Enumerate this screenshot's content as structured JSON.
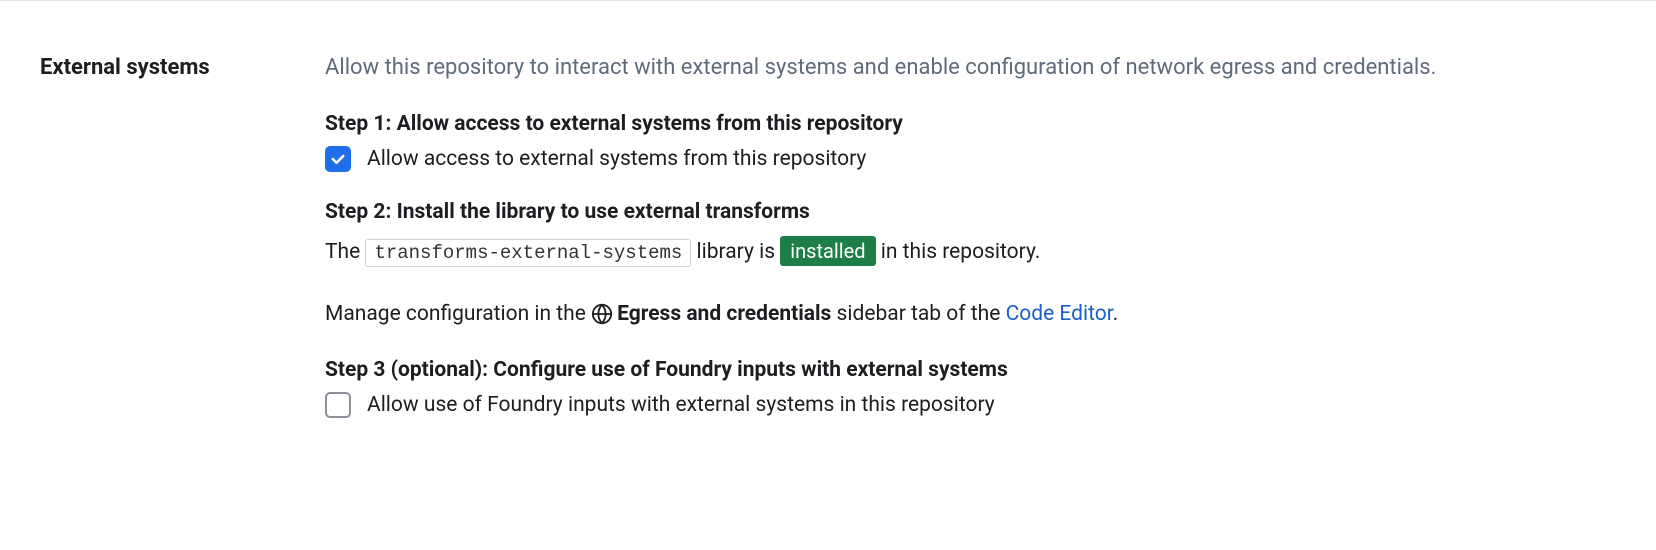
{
  "section": {
    "label": "External systems",
    "description": "Allow this repository to interact with external systems and enable configuration of network egress and credentials."
  },
  "step1": {
    "title": "Step 1: Allow access to external systems from this repository",
    "checkbox_label": "Allow access to external systems from this repository",
    "checked": true
  },
  "step2": {
    "title": "Step 2: Install the library to use external transforms",
    "prefix": "The ",
    "library_name": "transforms-external-systems",
    "mid1": " library is ",
    "status": "installed",
    "suffix": " in this repository."
  },
  "manage": {
    "prefix": "Manage configuration in the ",
    "sidebar_label": "Egress and credentials",
    "mid": " sidebar tab of the ",
    "link_text": "Code Editor",
    "period": "."
  },
  "step3": {
    "title": "Step 3 (optional): Configure use of Foundry inputs with external systems",
    "checkbox_label": "Allow use of Foundry inputs with external systems in this repository",
    "checked": false
  }
}
